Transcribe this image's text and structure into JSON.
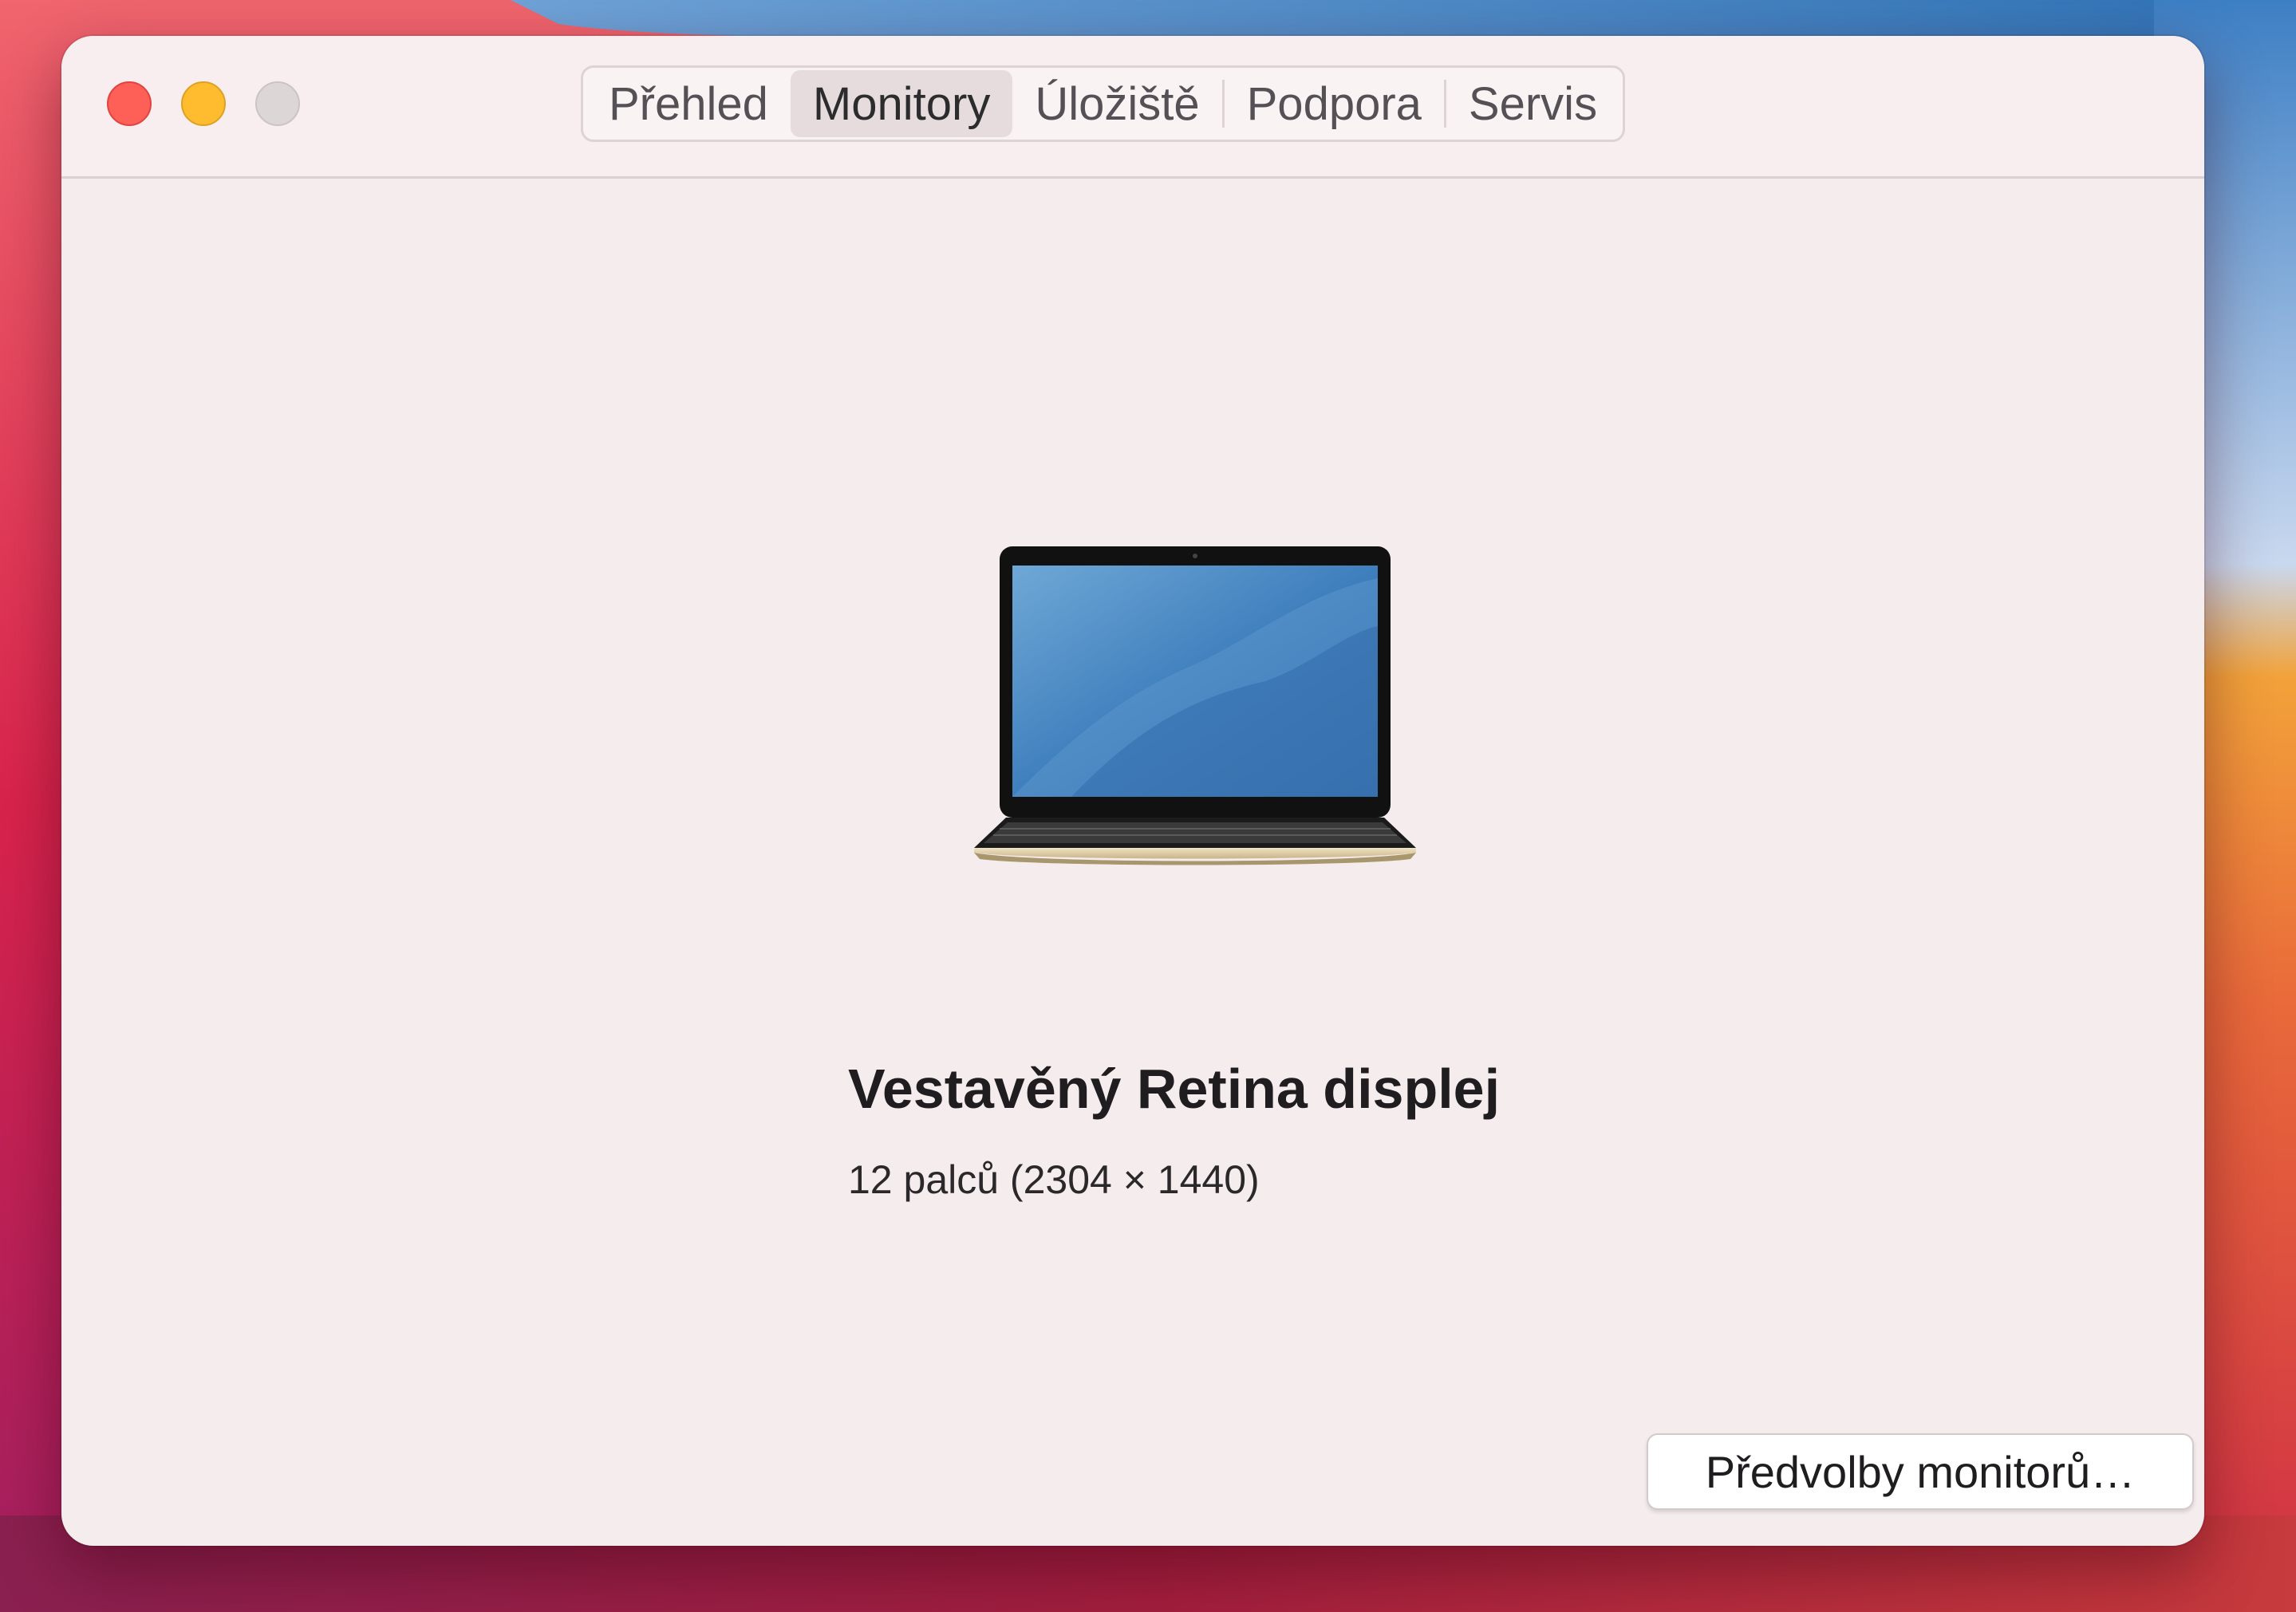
{
  "window": {
    "traffic_lights": {
      "close_color": "#fe5f57",
      "minimize_color": "#febc2e",
      "zoom_color": "#dcd6d7"
    },
    "tabs": [
      {
        "label": "Přehled",
        "active": false
      },
      {
        "label": "Monitory",
        "active": true
      },
      {
        "label": "Úložiště",
        "active": false
      },
      {
        "label": "Podpora",
        "active": false
      },
      {
        "label": "Servis",
        "active": false
      }
    ]
  },
  "display": {
    "icon": "macbook-laptop",
    "title": "Vestavěný Retina displej",
    "subtitle": "12 palců (2304 × 1440)"
  },
  "actions": {
    "preferences_label": "Předvolby monitorů…"
  },
  "colors": {
    "window_background": "#f5eced",
    "accent_active_tab": "#e6dcdd"
  }
}
